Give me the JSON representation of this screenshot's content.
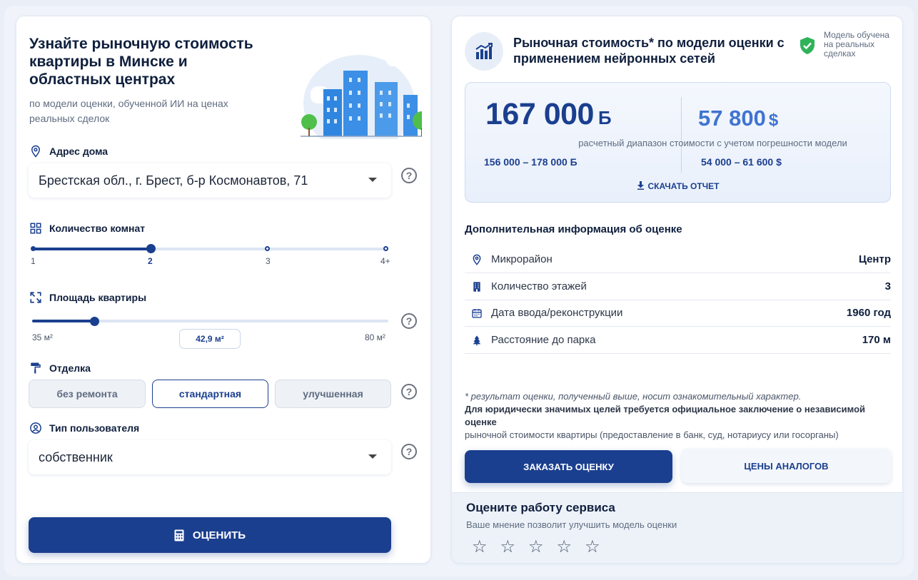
{
  "form": {
    "title": "Узнайте рыночную стоимость квартиры в Минске и областных центрах",
    "subtitle": "по модели оценки, обученной ИИ на ценах реальных сделок",
    "address": {
      "label": "Адрес дома",
      "value": "Брестская обл., г. Брест, б-р Космонавтов, 71"
    },
    "rooms": {
      "label": "Количество комнат",
      "options": [
        "1",
        "2",
        "3",
        "4+"
      ],
      "selected": "2"
    },
    "area": {
      "label": "Площадь квартиры",
      "min_label": "35 м²",
      "max_label": "80 м²",
      "value_label": "42,9 м²",
      "min": 35,
      "max": 80,
      "value": 42.9
    },
    "finish": {
      "label": "Отделка",
      "options": [
        "без ремонта",
        "стандартная",
        "улучшенная"
      ],
      "selected": "стандартная"
    },
    "user_type": {
      "label": "Тип пользователя",
      "value": "собственник"
    },
    "submit_label": "ОЦЕНИТЬ"
  },
  "result": {
    "title": "Рыночная стоимость* по модели оценки с применением нейронных сетей",
    "model_note": "Модель обучена на реальных сделках",
    "price_byn": "167 000",
    "currency_byn": "Ƃ",
    "price_usd": "57 800",
    "currency_usd": "$",
    "range_caption": "расчетный диапазон стоимости с учетом погрешности модели",
    "range_byn": "156 000 – 178 000 Ƃ",
    "range_usd": "54 000 – 61 600 $",
    "download_label": "СКАЧАТЬ ОТЧЕТ",
    "info_title": "Дополнительная информация об оценке",
    "info_rows": [
      {
        "label": "Микрорайон",
        "value": "Центр",
        "icon": "location-pin-icon"
      },
      {
        "label": "Количество этажей",
        "value": "3",
        "icon": "building-icon"
      },
      {
        "label": "Дата ввода/реконструкции",
        "value": "1960 год",
        "icon": "calendar-icon"
      },
      {
        "label": "Расстояние до парка",
        "value": "170 м",
        "icon": "tree-icon"
      }
    ],
    "disclaimer_note": "* результат оценки, полученный выше, носит ознакомительный характер.",
    "disclaimer_bold": "Для юридически значимых целей требуется официальное заключение о независимой оценке",
    "disclaimer_rest": "рыночной стоимости квартиры (предоставление в банк, суд, нотариусу или госорганы)",
    "order_label": "ЗАКАЗАТЬ ОЦЕНКУ",
    "analogs_label": "ЦЕНЫ АНАЛОГОВ"
  },
  "rating": {
    "title": "Оцените работу сервиса",
    "subtitle": "Ваше мнение позволит улучшить модель оценки",
    "max_stars": 5,
    "star_glyph": "☆"
  },
  "colors": {
    "primary": "#1b3f8f",
    "accent": "#3f74d1",
    "success": "#2fb35a"
  }
}
